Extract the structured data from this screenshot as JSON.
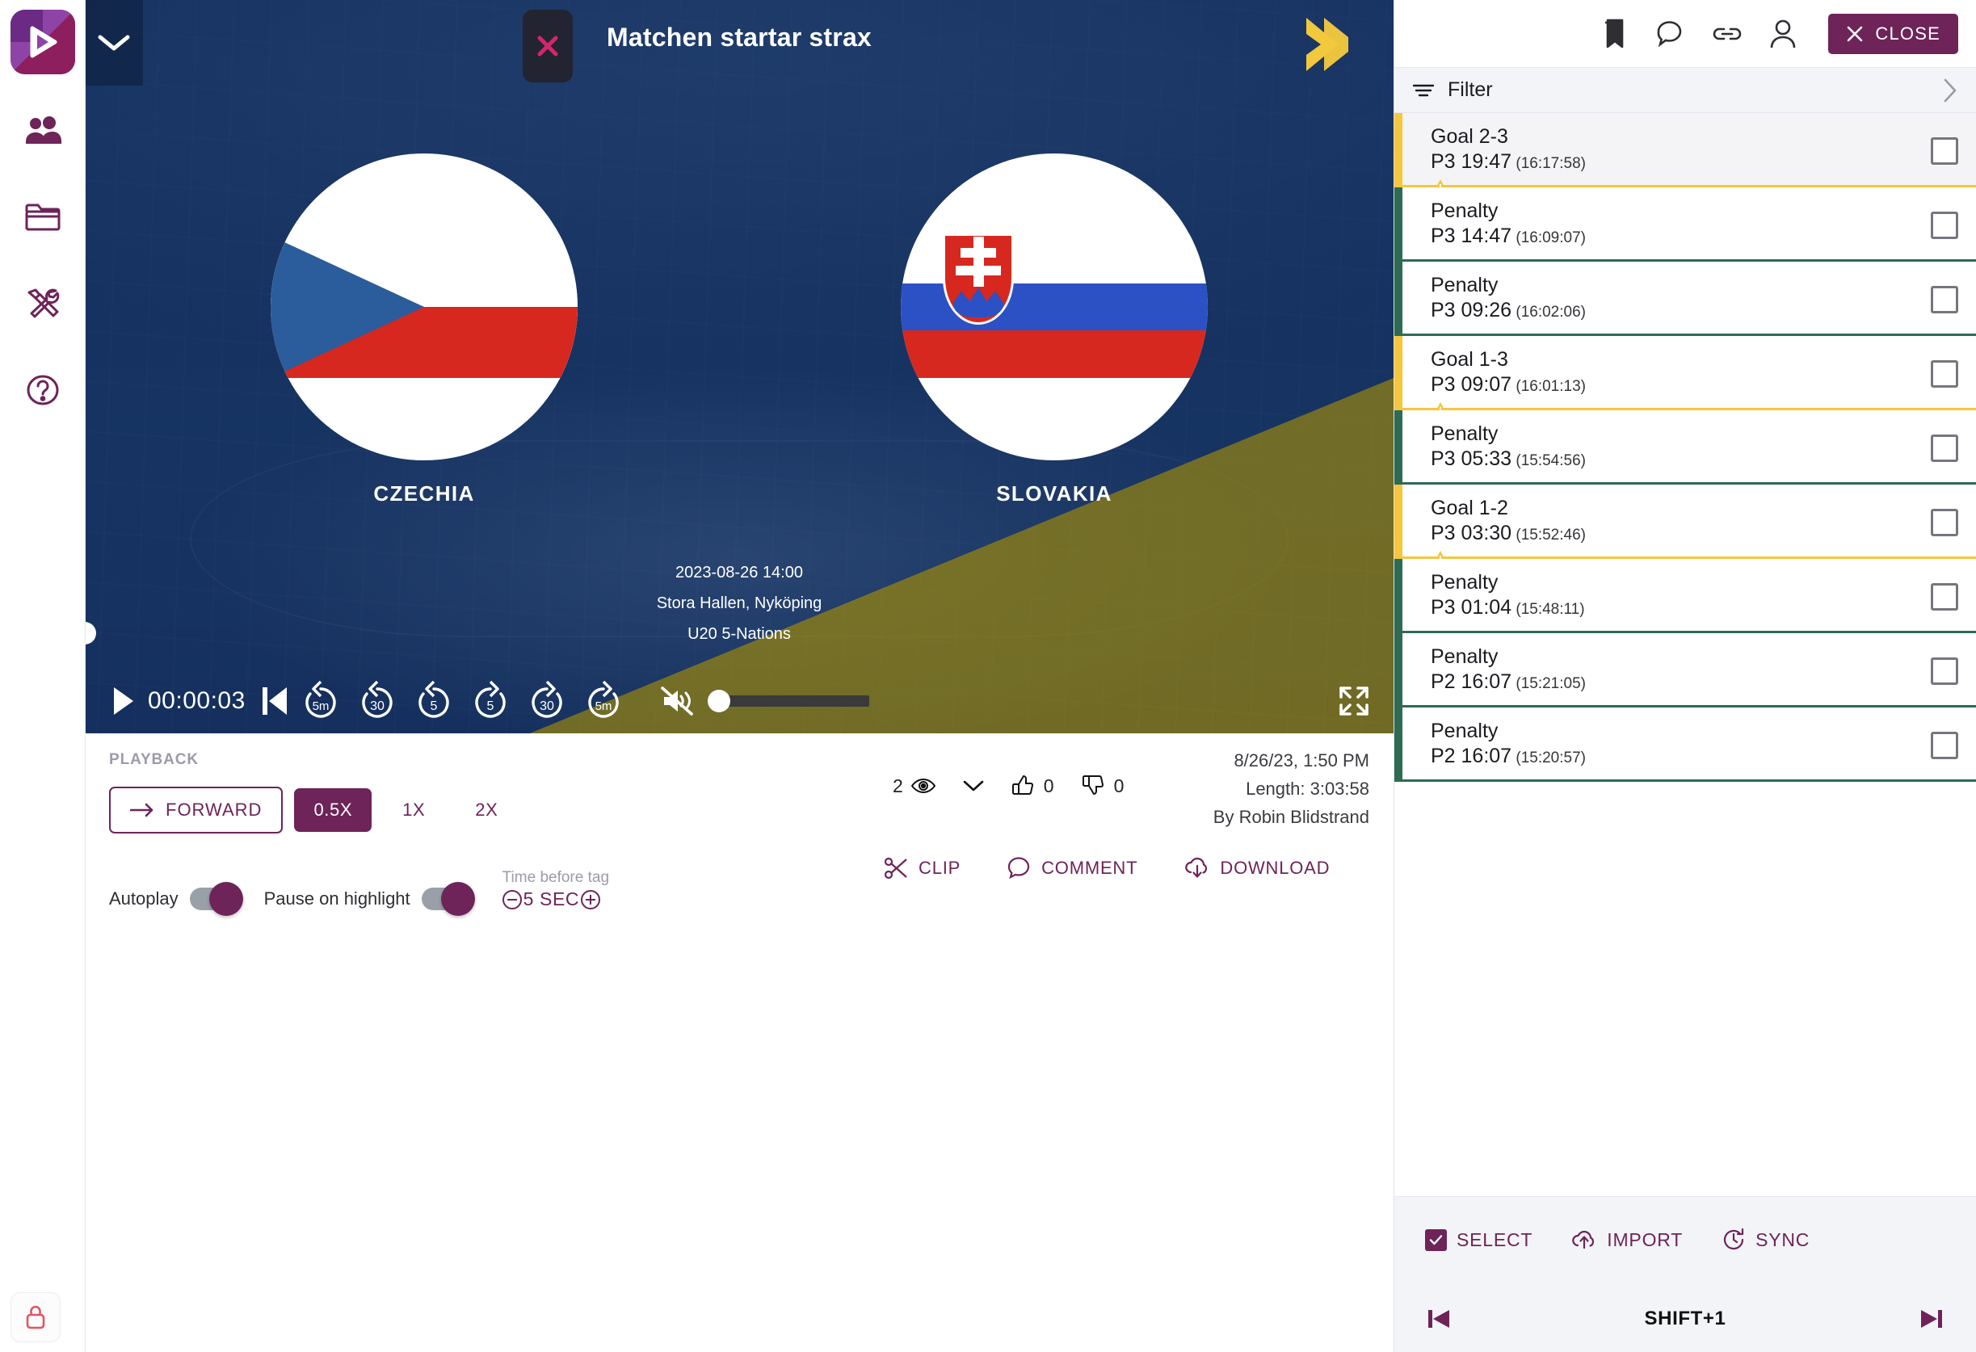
{
  "app": {
    "logo_name": "play-logo",
    "rail_items": [
      {
        "icon": "users-icon",
        "name": "sidebar-item-teams"
      },
      {
        "icon": "folder-icon",
        "name": "sidebar-item-library"
      },
      {
        "icon": "tools-icon",
        "name": "sidebar-item-tools"
      },
      {
        "icon": "help-icon",
        "name": "sidebar-item-help"
      }
    ],
    "lock_icon": "lock-icon"
  },
  "video": {
    "overlay_title": "Matchen startar strax",
    "collapse_icon": "chevron-down-icon",
    "badge_icon": "x-logo-icon",
    "corner_icon": "chevron-right-icon",
    "home_team": "CZECHIA",
    "away_team": "SLOVAKIA",
    "meta_datetime": "2023-08-26 14:00",
    "meta_venue": "Stora Hallen, Nyköping",
    "meta_competition": "U20 5-Nations",
    "current_time": "00:00:03",
    "skip_back": [
      "5m",
      "30",
      "5"
    ],
    "skip_fwd": [
      "5",
      "30",
      "5m"
    ],
    "volume_muted": true,
    "volume_level": 0,
    "fullscreen_icon": "fullscreen-icon"
  },
  "playback": {
    "section_label": "PLAYBACK",
    "direction_label": "FORWARD",
    "speeds": [
      "0.5X",
      "1X",
      "2X"
    ],
    "active_speed": "0.5X",
    "autoplay_label": "Autoplay",
    "autoplay_on": true,
    "pause_label": "Pause on highlight",
    "pause_on": true,
    "time_before_tag_label": "Time before tag",
    "time_before_tag_value": "5 SEC"
  },
  "info": {
    "views_count": "2",
    "likes_count": "0",
    "dislikes_count": "0",
    "created_at": "8/26/23, 1:50 PM",
    "length": "Length: 3:03:58",
    "author": "By Robin Blidstrand",
    "actions": [
      {
        "label": "CLIP",
        "icon": "scissors-icon"
      },
      {
        "label": "COMMENT",
        "icon": "comment-icon"
      },
      {
        "label": "DOWNLOAD",
        "icon": "download-cloud-icon"
      }
    ]
  },
  "right_panel": {
    "toolbar_icons": [
      "bookmark-icon",
      "comment-icon",
      "link-icon",
      "user-icon"
    ],
    "close_label": "CLOSE",
    "filter_label": "Filter",
    "events": [
      {
        "title": "Goal 2-3",
        "time": "P3 19:47",
        "clock": "(16:17:58)",
        "type": "goal",
        "warn": true,
        "selected": true
      },
      {
        "title": "Penalty",
        "time": "P3 14:47",
        "clock": "(16:09:07)",
        "type": "penalty",
        "warn": false,
        "selected": false
      },
      {
        "title": "Penalty",
        "time": "P3 09:26",
        "clock": "(16:02:06)",
        "type": "penalty",
        "warn": false,
        "selected": false
      },
      {
        "title": "Goal 1-3",
        "time": "P3 09:07",
        "clock": "(16:01:13)",
        "type": "goal",
        "warn": true,
        "selected": false
      },
      {
        "title": "Penalty",
        "time": "P3 05:33",
        "clock": "(15:54:56)",
        "type": "penalty",
        "warn": false,
        "selected": false
      },
      {
        "title": "Goal 1-2",
        "time": "P3 03:30",
        "clock": "(15:52:46)",
        "type": "goal",
        "warn": true,
        "selected": false
      },
      {
        "title": "Penalty",
        "time": "P3 01:04",
        "clock": "(15:48:11)",
        "type": "penalty",
        "warn": false,
        "selected": false
      },
      {
        "title": "Penalty",
        "time": "P2 16:07",
        "clock": "(15:21:05)",
        "type": "penalty",
        "warn": false,
        "selected": false
      },
      {
        "title": "Penalty",
        "time": "P2 16:07",
        "clock": "(15:20:57)",
        "type": "penalty",
        "warn": false,
        "selected": false
      }
    ],
    "tools": [
      {
        "label": "SELECT",
        "icon": "checkbox-checked-icon"
      },
      {
        "label": "IMPORT",
        "icon": "import-cloud-icon"
      },
      {
        "label": "SYNC",
        "icon": "sync-clock-icon"
      }
    ],
    "shift_label": "SHIFT+1",
    "prev_icon": "skip-previous-icon",
    "next_icon": "skip-next-icon"
  },
  "colors": {
    "brand_purple": "#6e2359",
    "goal_yellow": "#f6c63c",
    "penalty_green": "#2d6b52",
    "lock_red": "#e05563"
  }
}
